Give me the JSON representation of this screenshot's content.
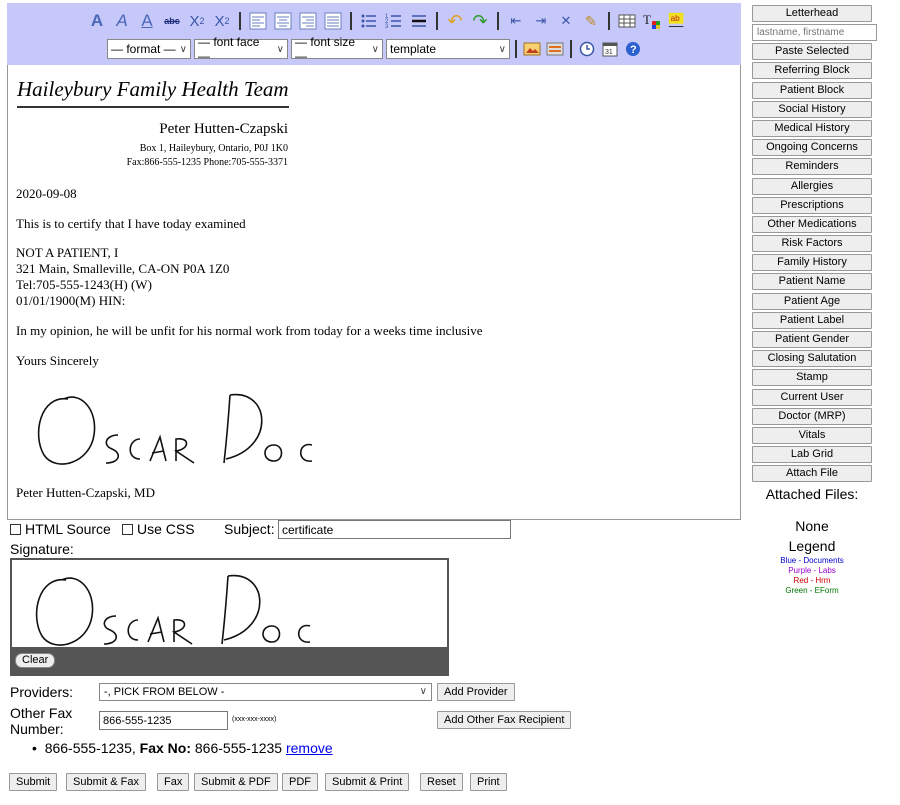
{
  "toolbar": {
    "icons_row1": [
      "font-bold-icon",
      "font-italic-icon",
      "underline-icon",
      "strikethrough-icon",
      "subscript-icon",
      "superscript-icon",
      "justify-left-icon",
      "justify-center-icon",
      "justify-right-icon",
      "justify-full-icon",
      "bulleted-list-icon",
      "numbered-list-icon",
      "horizontal-rule-icon",
      "undo-icon",
      "redo-icon",
      "outdent-icon",
      "indent-icon",
      "clear-format-icon",
      "eyedropper-icon",
      "table-icon",
      "text-color-icon",
      "highlight-color-icon"
    ],
    "format_select": "— format —",
    "font_face_select": "— font face —",
    "font_size_select": "— font size —",
    "template_select": "template"
  },
  "letter": {
    "clinic_title": "Haileybury Family Health Team",
    "doctor_name": "Peter Hutten-Czapski",
    "doctor_address": "Box 1, Haileybury, Ontario, P0J 1K0",
    "doctor_contact": "Fax:866-555-1235 Phone:705-555-3371",
    "date": "2020-09-08",
    "intro": "This is to certify that I have today examined",
    "patient_name": "NOT A PATIENT, I",
    "patient_address": "321 Main, Smalleville, CA-ON P0A 1Z0",
    "patient_tel": "Tel:705-555-1243(H) (W)",
    "patient_dob_hin": "01/01/1900(M) HIN:",
    "opinion": "In my opinion, he will be unfit for his normal work from today for a weeks time inclusive",
    "closing": "Yours Sincerely",
    "signature_text": "Oscar Doc",
    "signoff": "Peter Hutten-Czapski, MD"
  },
  "right_panel": {
    "letterhead": "Letterhead",
    "search_placeholder": "lastname, firstname",
    "buttons": [
      "Paste Selected",
      "Referring Block",
      "Patient Block",
      "Social History",
      "Medical History",
      "Ongoing Concerns",
      "Reminders",
      "Allergies",
      "Prescriptions",
      "Other Medications",
      "Risk Factors",
      "Family History",
      "Patient Name",
      "Patient Age",
      "Patient Label",
      "Patient Gender",
      "Closing Salutation",
      "Stamp",
      "Current User",
      "Doctor (MRP)",
      "Vitals",
      "Lab Grid",
      "Attach File"
    ],
    "attached_files_label": "Attached Files:",
    "attached_none": "None",
    "legend_label": "Legend",
    "legend_items": [
      {
        "text": "Blue - Documents",
        "color": "#0000cc"
      },
      {
        "text": "Purple - Labs",
        "color": "#9900cc"
      },
      {
        "text": "Red - Hrm",
        "color": "#cc0000"
      },
      {
        "text": "Green - EForm",
        "color": "#007700"
      }
    ]
  },
  "form": {
    "html_source_label": "HTML Source",
    "use_css_label": "Use CSS",
    "subject_label": "Subject:",
    "subject_value": "certificate",
    "signature_label": "Signature:",
    "clear_label": "Clear",
    "providers_label": "Providers:",
    "providers_value": "-, PICK FROM BELOW -",
    "add_provider_label": "Add Provider",
    "other_fax_label_1": "Other Fax",
    "other_fax_label_2": "Number:",
    "other_fax_value": "866-555-1235",
    "other_fax_hint": "(xxx-xxx-xxxx)",
    "add_other_fax_label": "Add Other Fax Recipient",
    "fax_entry_number": "866-555-1235,",
    "fax_entry_fax_label": "Fax No:",
    "fax_entry_fax_number": "866-555-1235",
    "fax_entry_remove": "remove"
  },
  "actions": {
    "submit": "Submit",
    "submit_fax": "Submit & Fax",
    "fax": "Fax",
    "submit_pdf": "Submit & PDF",
    "pdf": "PDF",
    "submit_print": "Submit & Print",
    "reset": "Reset",
    "print": "Print"
  }
}
